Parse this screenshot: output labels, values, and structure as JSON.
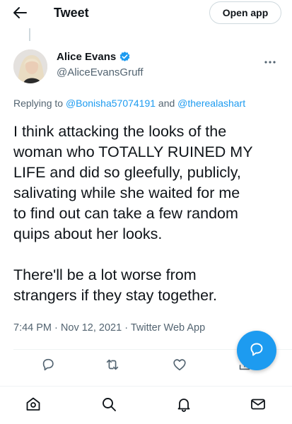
{
  "header": {
    "title": "Tweet",
    "open_app_label": "Open app"
  },
  "tweet": {
    "display_name": "Alice Evans",
    "handle": "@AliceEvansGruff",
    "replying_prefix": "Replying to",
    "mentions": [
      "@Bonisha57074191",
      "@therealashart"
    ],
    "replying_conjunction": "and",
    "text_lines": [
      "I think attacking the looks of the",
      "woman who TOTALLY RUINED MY",
      "LIFE and did so gleefully, publicly,",
      "salivating while she waited for me",
      "to find out can take a few random",
      "quips about her looks."
    ],
    "text_lines_2": [
      "There'll be a lot worse from",
      "strangers if they stay together."
    ],
    "time": "7:44 PM",
    "date": "Nov 12, 2021",
    "source": "Twitter Web App",
    "separator": "·"
  },
  "icons": {
    "back": "back-arrow-icon",
    "verified": "verified-badge-icon",
    "more": "more-options-icon",
    "reply": "reply-icon",
    "retweet": "retweet-icon",
    "like": "like-icon",
    "share": "share-icon",
    "compose": "compose-reply-icon",
    "nav": [
      "home-icon",
      "search-icon",
      "notifications-icon",
      "messages-icon"
    ]
  },
  "colors": {
    "accent": "#1d9bf0",
    "text": "#0f1419",
    "secondary": "#536471"
  }
}
